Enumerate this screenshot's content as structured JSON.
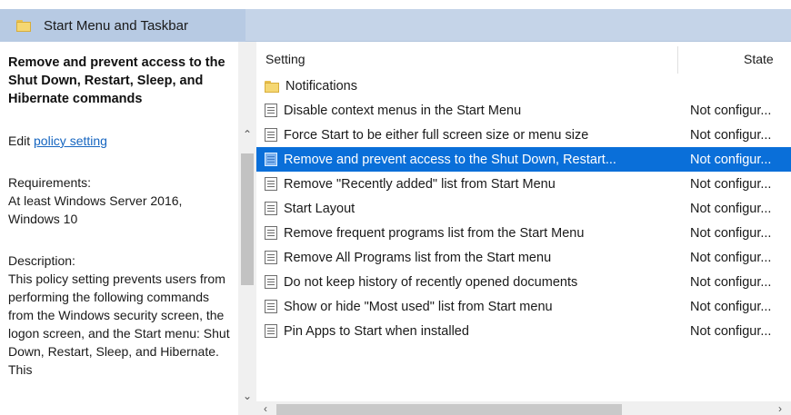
{
  "header": {
    "title": "Start Menu and Taskbar",
    "icon": "folder-icon"
  },
  "left_pane": {
    "policy_title": "Remove and prevent access to the Shut Down, Restart, Sleep, and Hibernate commands",
    "edit_prefix": "Edit",
    "edit_link": "policy setting",
    "requirements_label": "Requirements:",
    "requirements_text": "At least Windows Server 2016, Windows 10",
    "description_label": "Description:",
    "description_text": "This policy setting prevents users from performing the following commands from the Windows security screen, the logon screen, and the Start menu: Shut Down, Restart, Sleep, and Hibernate. This"
  },
  "columns": {
    "setting": "Setting",
    "state": "State"
  },
  "rows": [
    {
      "type": "folder",
      "name": "Notifications",
      "state": ""
    },
    {
      "type": "policy",
      "name": "Disable context menus in the Start Menu",
      "state": "Not configur..."
    },
    {
      "type": "policy",
      "name": "Force Start to be either full screen size or menu size",
      "state": "Not configur..."
    },
    {
      "type": "policy",
      "name": "Remove and prevent access to the Shut Down, Restart...",
      "state": "Not configur...",
      "selected": true
    },
    {
      "type": "policy",
      "name": "Remove \"Recently added\" list from Start Menu",
      "state": "Not configur..."
    },
    {
      "type": "policy",
      "name": "Start Layout",
      "state": "Not configur..."
    },
    {
      "type": "policy",
      "name": "Remove frequent programs list from the Start Menu",
      "state": "Not configur..."
    },
    {
      "type": "policy",
      "name": "Remove All Programs list from the Start menu",
      "state": "Not configur..."
    },
    {
      "type": "policy",
      "name": "Do not keep history of recently opened documents",
      "state": "Not configur..."
    },
    {
      "type": "policy",
      "name": "Show or hide \"Most used\" list from Start menu",
      "state": "Not configur..."
    },
    {
      "type": "policy",
      "name": "Pin Apps to Start when installed",
      "state": "Not configur..."
    }
  ],
  "colors": {
    "selection": "#0a6fd9",
    "header_bar": "#c5d4e8",
    "link": "#1565c0"
  }
}
